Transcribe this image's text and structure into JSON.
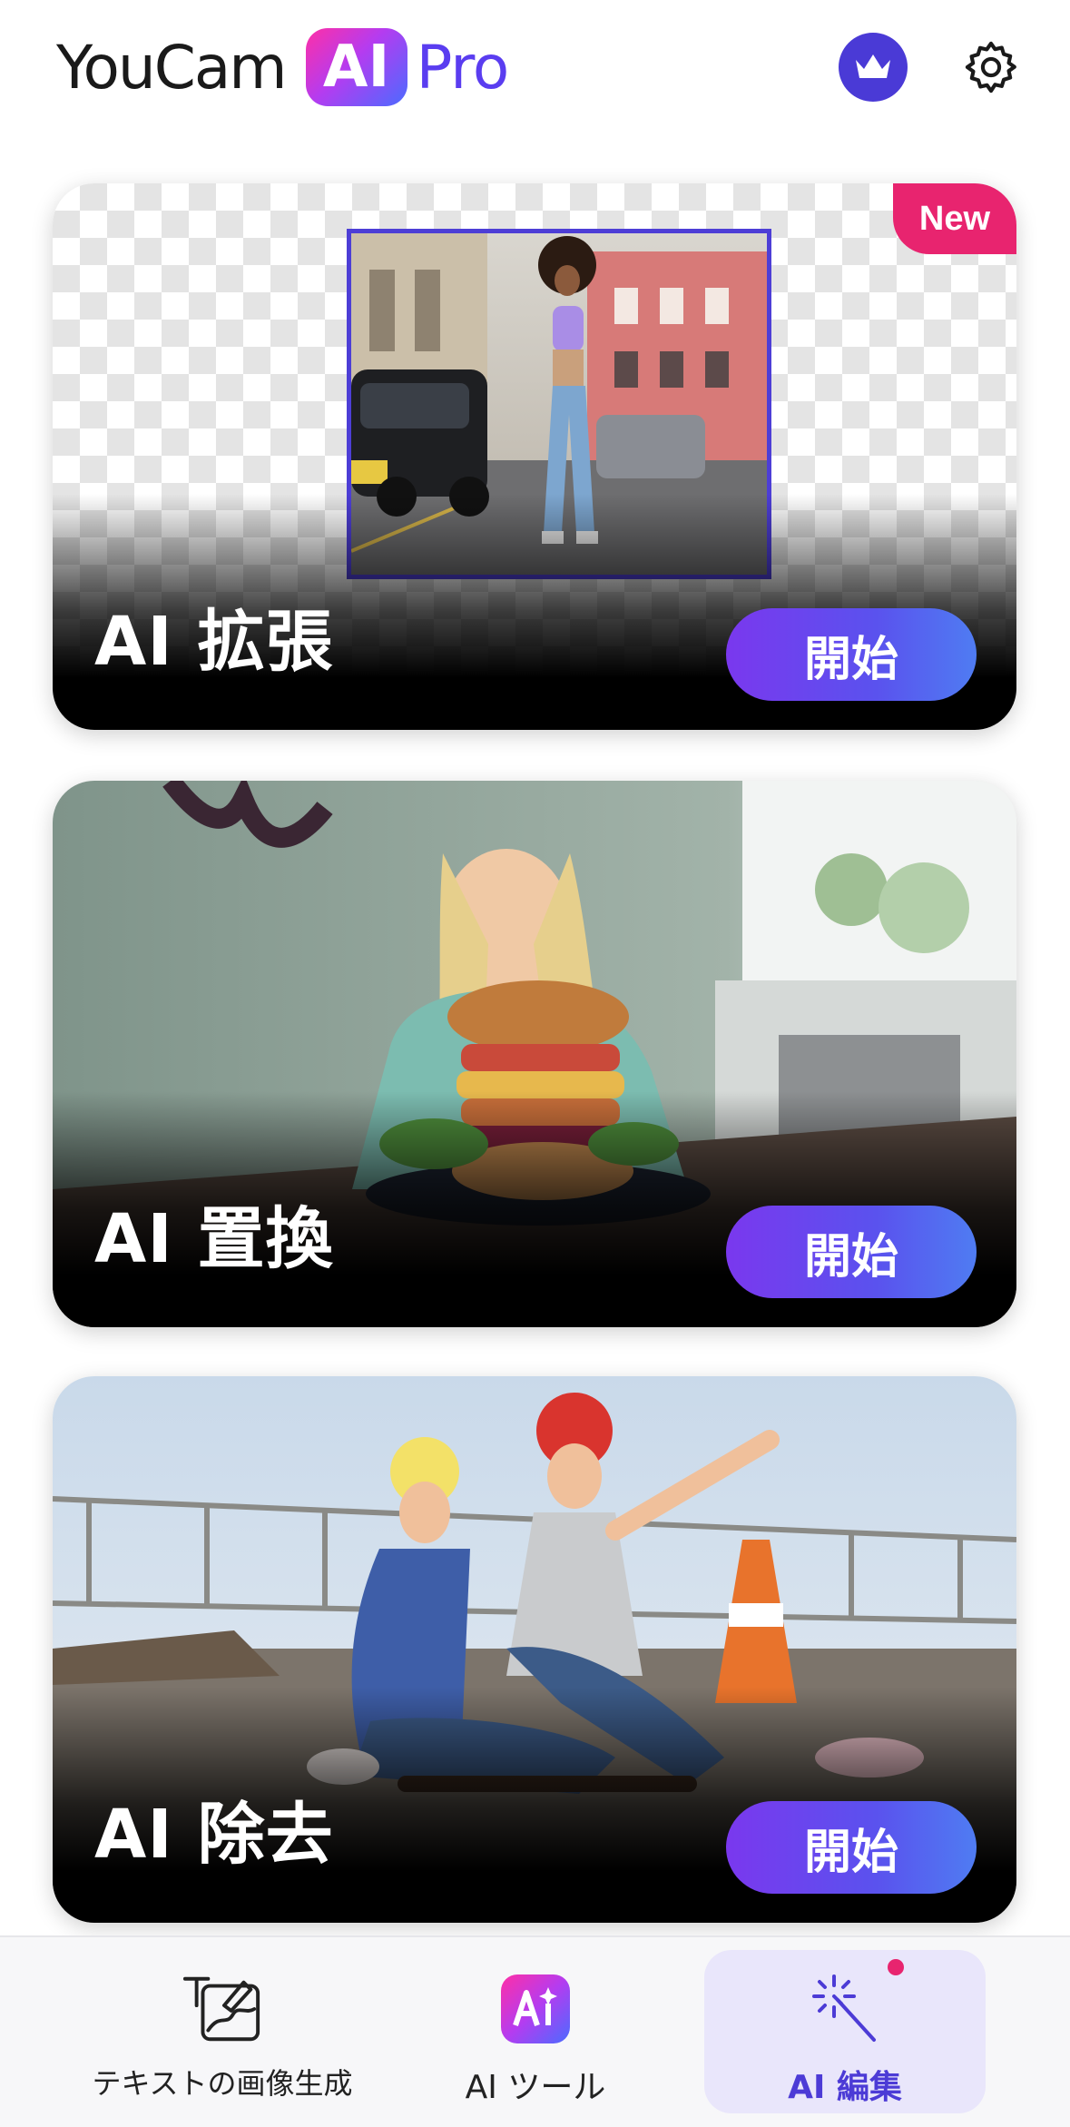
{
  "header": {
    "logo_youcam": "YouCam",
    "logo_ai": "AI",
    "logo_pro": "Pro",
    "crown_icon": "crown-icon",
    "settings_icon": "gear-icon"
  },
  "cards": [
    {
      "title": "AI 拡張",
      "button_label": "開始",
      "badge": "New"
    },
    {
      "title": "AI 置換",
      "button_label": "開始"
    },
    {
      "title": "AI 除去",
      "button_label": "開始"
    }
  ],
  "bottom_nav": {
    "items": [
      {
        "label": "テキストの画像生成",
        "icon": "text-to-image-icon"
      },
      {
        "label": "AI ツール",
        "icon": "ai-tools-icon"
      },
      {
        "label": "AI 編集",
        "icon": "magic-wand-icon",
        "selected": true
      }
    ]
  },
  "colors": {
    "accent": "#4c3bd6",
    "button_gradient_start": "#7a38ee",
    "button_gradient_end": "#4f7cf2",
    "new_badge": "#e8246f"
  }
}
